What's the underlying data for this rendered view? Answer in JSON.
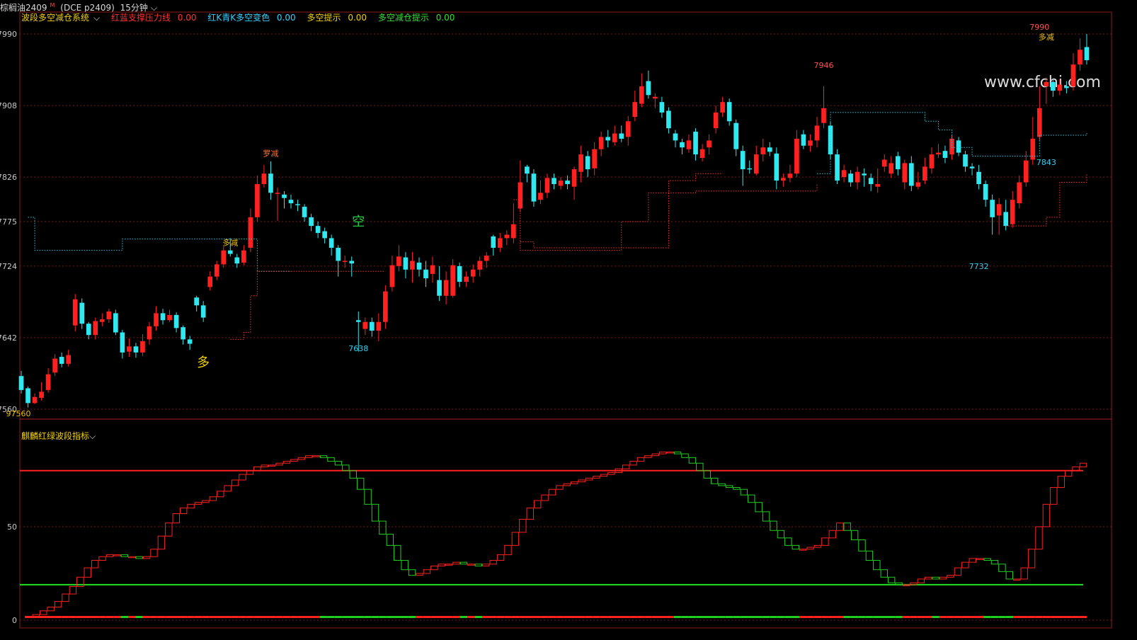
{
  "header": {
    "symbol": "棕榈油2409",
    "superscript": "M",
    "code": "(DCE  p2409)",
    "period": "15分钟"
  },
  "indicators": {
    "system_name": "波段多空减仓系统",
    "items": [
      {
        "label": "红蓝支撑压力线",
        "value": "0.00",
        "color": "#ff3030"
      },
      {
        "label": "红K青K多空变色",
        "value": "0.00",
        "color": "#30d0ff"
      },
      {
        "label": "多空提示",
        "value": "0.00",
        "color": "#f0d000"
      },
      {
        "label": "多空减仓提示",
        "value": "0.00",
        "color": "#30e030"
      }
    ]
  },
  "sub_indicator": {
    "name": "麒麟红绿波段指标"
  },
  "watermark": "www.cfchi.com",
  "chart_data": [
    {
      "type": "candlestick",
      "y_ticks": [
        "7990",
        "7908",
        "7826",
        "7775",
        "7724",
        "7642",
        "7560"
      ],
      "ylim": [
        7560,
        7990
      ],
      "candles": [
        [
          7598,
          7582,
          7604,
          7578
        ],
        [
          7584,
          7567,
          7586,
          7562
        ],
        [
          7567,
          7574,
          7578,
          7566
        ],
        [
          7573,
          7580,
          7591,
          7570
        ],
        [
          7582,
          7600,
          7607,
          7579
        ],
        [
          7602,
          7618,
          7623,
          7598
        ],
        [
          7620,
          7612,
          7625,
          7608
        ],
        [
          7612,
          7622,
          7628,
          7609
        ],
        [
          7656,
          7686,
          7692,
          7649
        ],
        [
          7682,
          7658,
          7687,
          7652
        ],
        [
          7658,
          7645,
          7660,
          7640
        ],
        [
          7645,
          7661,
          7665,
          7640
        ],
        [
          7660,
          7663,
          7670,
          7655
        ],
        [
          7663,
          7672,
          7675,
          7659
        ],
        [
          7670,
          7648,
          7674,
          7645
        ],
        [
          7648,
          7625,
          7651,
          7618
        ],
        [
          7626,
          7632,
          7641,
          7620
        ],
        [
          7632,
          7625,
          7636,
          7619
        ],
        [
          7625,
          7638,
          7646,
          7621
        ],
        [
          7640,
          7655,
          7660,
          7634
        ],
        [
          7655,
          7670,
          7678,
          7650
        ],
        [
          7670,
          7662,
          7675,
          7657
        ],
        [
          7662,
          7668,
          7674,
          7660
        ],
        [
          7668,
          7653,
          7671,
          7648
        ],
        [
          7654,
          7640,
          7656,
          7634
        ],
        [
          7640,
          7635,
          7644,
          7628
        ],
        [
          7688,
          7679,
          7690,
          7672
        ],
        [
          7679,
          7665,
          7684,
          7660
        ],
        [
          7700,
          7712,
          7718,
          7696
        ],
        [
          7712,
          7726,
          7730,
          7708
        ],
        [
          7726,
          7742,
          7746,
          7722
        ],
        [
          7742,
          7738,
          7756,
          7735
        ],
        [
          7734,
          7727,
          7738,
          7722
        ],
        [
          7728,
          7742,
          7748,
          7725
        ],
        [
          7745,
          7780,
          7790,
          7740
        ],
        [
          7780,
          7818,
          7828,
          7775
        ],
        [
          7818,
          7830,
          7840,
          7814
        ],
        [
          7830,
          7808,
          7844,
          7800
        ],
        [
          7808,
          7808,
          7814,
          7776
        ],
        [
          7806,
          7802,
          7810,
          7790
        ],
        [
          7800,
          7796,
          7806,
          7790
        ],
        [
          7795,
          7794,
          7800,
          7787
        ],
        [
          7792,
          7780,
          7795,
          7775
        ],
        [
          7780,
          7770,
          7784,
          7764
        ],
        [
          7770,
          7762,
          7775,
          7756
        ],
        [
          7764,
          7756,
          7768,
          7750
        ],
        [
          7756,
          7745,
          7760,
          7736
        ],
        [
          7745,
          7730,
          7748,
          7712
        ],
        [
          7730,
          7730,
          7736,
          7722
        ],
        [
          7730,
          7727,
          7735,
          7712
        ],
        [
          7662,
          7660,
          7672,
          7626
        ],
        [
          7652,
          7660,
          7665,
          7645
        ],
        [
          7660,
          7650,
          7665,
          7643
        ],
        [
          7650,
          7660,
          7670,
          7638
        ],
        [
          7660,
          7695,
          7702,
          7652
        ],
        [
          7700,
          7725,
          7736,
          7695
        ],
        [
          7724,
          7735,
          7748,
          7718
        ],
        [
          7734,
          7720,
          7740,
          7710
        ],
        [
          7720,
          7730,
          7740,
          7705
        ],
        [
          7728,
          7720,
          7734,
          7712
        ],
        [
          7720,
          7710,
          7730,
          7700
        ],
        [
          7715,
          7725,
          7735,
          7705
        ],
        [
          7708,
          7690,
          7724,
          7684
        ],
        [
          7690,
          7708,
          7718,
          7680
        ],
        [
          7690,
          7725,
          7732,
          7688
        ],
        [
          7724,
          7706,
          7728,
          7700
        ],
        [
          7706,
          7712,
          7718,
          7700
        ],
        [
          7712,
          7720,
          7726,
          7705
        ],
        [
          7720,
          7730,
          7735,
          7712
        ],
        [
          7730,
          7736,
          7740,
          7722
        ],
        [
          7758,
          7745,
          7760,
          7736
        ],
        [
          7745,
          7756,
          7762,
          7740
        ],
        [
          7756,
          7760,
          7765,
          7748
        ],
        [
          7756,
          7772,
          7796,
          7750
        ],
        [
          7790,
          7820,
          7845,
          7786
        ],
        [
          7838,
          7830,
          7840,
          7820
        ],
        [
          7830,
          7798,
          7835,
          7792
        ],
        [
          7800,
          7808,
          7822,
          7795
        ],
        [
          7808,
          7825,
          7830,
          7802
        ],
        [
          7825,
          7818,
          7830,
          7812
        ],
        [
          7816,
          7822,
          7826,
          7812
        ],
        [
          7822,
          7818,
          7828,
          7812
        ],
        [
          7815,
          7835,
          7838,
          7800
        ],
        [
          7832,
          7852,
          7862,
          7820
        ],
        [
          7850,
          7835,
          7856,
          7826
        ],
        [
          7836,
          7858,
          7866,
          7828
        ],
        [
          7858,
          7872,
          7878,
          7850
        ],
        [
          7872,
          7868,
          7880,
          7860
        ],
        [
          7866,
          7876,
          7885,
          7862
        ],
        [
          7876,
          7870,
          7885,
          7866
        ],
        [
          7872,
          7890,
          7896,
          7862
        ],
        [
          7895,
          7912,
          7925,
          7890
        ],
        [
          7910,
          7930,
          7945,
          7906
        ],
        [
          7936,
          7920,
          7948,
          7916
        ],
        [
          7916,
          7918,
          7922,
          7905
        ],
        [
          7912,
          7900,
          7918,
          7894
        ],
        [
          7902,
          7882,
          7906,
          7876
        ],
        [
          7876,
          7868,
          7880,
          7860
        ],
        [
          7866,
          7860,
          7870,
          7852
        ],
        [
          7858,
          7868,
          7875,
          7854
        ],
        [
          7878,
          7852,
          7882,
          7845
        ],
        [
          7848,
          7858,
          7864,
          7844
        ],
        [
          7860,
          7868,
          7875,
          7852
        ],
        [
          7882,
          7900,
          7908,
          7876
        ],
        [
          7900,
          7912,
          7918,
          7895
        ],
        [
          7912,
          7890,
          7916,
          7885
        ],
        [
          7888,
          7858,
          7892,
          7850
        ],
        [
          7856,
          7835,
          7862,
          7816
        ],
        [
          7836,
          7835,
          7845,
          7830
        ],
        [
          7830,
          7852,
          7862,
          7828
        ],
        [
          7852,
          7860,
          7870,
          7844
        ],
        [
          7860,
          7855,
          7866,
          7850
        ],
        [
          7853,
          7822,
          7860,
          7812
        ],
        [
          7822,
          7825,
          7830,
          7815
        ],
        [
          7825,
          7830,
          7840,
          7820
        ],
        [
          7830,
          7870,
          7880,
          7826
        ],
        [
          7875,
          7862,
          7880,
          7858
        ],
        [
          7862,
          7868,
          7875,
          7855
        ],
        [
          7868,
          7885,
          7895,
          7860
        ],
        [
          7888,
          7905,
          7930,
          7882
        ],
        [
          7885,
          7852,
          7890,
          7846
        ],
        [
          7852,
          7822,
          7858,
          7818
        ],
        [
          7826,
          7834,
          7840,
          7820
        ],
        [
          7830,
          7820,
          7834,
          7815
        ],
        [
          7820,
          7832,
          7838,
          7812
        ],
        [
          7830,
          7828,
          7836,
          7815
        ],
        [
          7825,
          7818,
          7830,
          7810
        ],
        [
          7815,
          7818,
          7836,
          7808
        ],
        [
          7838,
          7846,
          7852,
          7832
        ],
        [
          7830,
          7842,
          7850,
          7825
        ],
        [
          7850,
          7835,
          7855,
          7828
        ],
        [
          7820,
          7842,
          7846,
          7812
        ],
        [
          7842,
          7816,
          7850,
          7810
        ],
        [
          7815,
          7820,
          7832,
          7812
        ],
        [
          7822,
          7838,
          7848,
          7818
        ],
        [
          7836,
          7852,
          7860,
          7830
        ],
        [
          7852,
          7854,
          7864,
          7848
        ],
        [
          7856,
          7848,
          7862,
          7842
        ],
        [
          7852,
          7870,
          7874,
          7846
        ],
        [
          7868,
          7854,
          7872,
          7850
        ],
        [
          7852,
          7838,
          7856,
          7832
        ],
        [
          7838,
          7836,
          7842,
          7828
        ],
        [
          7832,
          7818,
          7840,
          7812
        ],
        [
          7818,
          7800,
          7822,
          7792
        ],
        [
          7800,
          7780,
          7806,
          7760
        ],
        [
          7782,
          7795,
          7802,
          7760
        ],
        [
          7786,
          7770,
          7800,
          7765
        ],
        [
          7772,
          7800,
          7810,
          7768
        ],
        [
          7796,
          7820,
          7828,
          7790
        ],
        [
          7820,
          7845,
          7856,
          7815
        ],
        [
          7846,
          7870,
          7895,
          7840
        ],
        [
          7872,
          7905,
          7930,
          7868
        ],
        [
          7930,
          7935,
          7940,
          7910
        ],
        [
          7935,
          7925,
          7938,
          7918
        ],
        [
          7925,
          7932,
          7938,
          7920
        ],
        [
          7930,
          7928,
          7936,
          7922
        ],
        [
          7930,
          7955,
          7968,
          7925
        ],
        [
          7955,
          7972,
          7985,
          7948
        ],
        [
          7975,
          7960,
          7990,
          7955
        ]
      ],
      "annotations": [
        {
          "text": "7990",
          "kind": "high"
        },
        {
          "text": "多减",
          "kind": "signal"
        },
        {
          "text": "7946",
          "kind": "high"
        },
        {
          "text": "7843",
          "kind": "level"
        },
        {
          "text": "7638",
          "kind": "low"
        },
        {
          "text": "7732",
          "kind": "low"
        },
        {
          "text": "97560",
          "kind": "low"
        },
        {
          "text": "多",
          "kind": "long"
        },
        {
          "text": "空",
          "kind": "short"
        },
        {
          "text": "多减",
          "kind": "signal"
        },
        {
          "text": "罗减",
          "kind": "signal"
        }
      ],
      "colors": {
        "up": "#ff2020",
        "down": "#30e8f0",
        "support": "#ff3030",
        "resistance": "#30c8e0"
      }
    },
    {
      "type": "line",
      "name": "麒麟红绿波段指标",
      "y_ticks": [
        "50",
        "0"
      ],
      "ylim": [
        0,
        100
      ],
      "upper_line": 80,
      "lower_line": 19,
      "values": [
        2,
        2,
        3,
        5,
        7,
        10,
        14,
        18,
        23,
        28,
        32,
        34,
        35,
        35,
        34,
        34,
        33,
        34,
        38,
        45,
        52,
        57,
        60,
        62,
        63,
        64,
        66,
        69,
        72,
        75,
        78,
        80,
        82,
        83,
        83,
        84,
        85,
        86,
        87,
        88,
        88,
        87,
        85,
        83,
        80,
        76,
        70,
        62,
        53,
        46,
        40,
        32,
        27,
        24,
        25,
        27,
        29,
        30,
        30,
        31,
        30,
        30,
        29,
        30,
        32,
        35,
        40,
        47,
        54,
        60,
        64,
        67,
        70,
        72,
        73,
        74,
        75,
        76,
        77,
        78,
        79,
        81,
        83,
        85,
        87,
        88,
        89,
        90,
        90,
        89,
        87,
        84,
        80,
        76,
        73,
        72,
        71,
        70,
        67,
        63,
        58,
        53,
        48,
        44,
        40,
        38,
        38,
        39,
        40,
        44,
        48,
        52,
        48,
        43,
        37,
        32,
        27,
        23,
        20,
        19,
        19,
        20,
        22,
        23,
        22,
        23,
        24,
        28,
        31,
        33,
        33,
        32,
        30,
        26,
        22,
        22,
        28,
        38,
        50,
        62,
        71,
        77,
        80,
        82,
        84
      ]
    }
  ]
}
